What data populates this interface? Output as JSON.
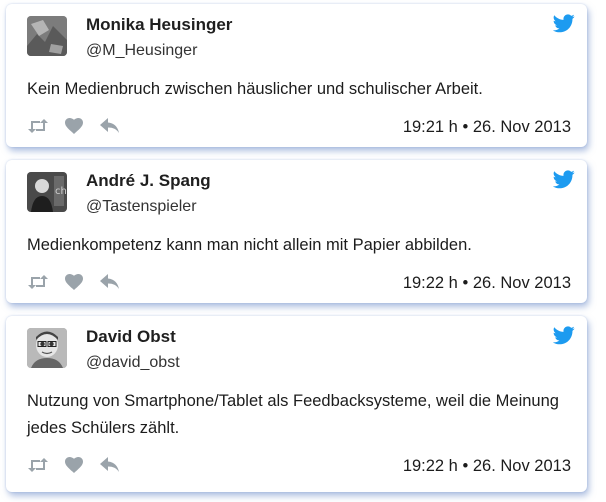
{
  "colors": {
    "twitter_blue": "#1d9bf0",
    "icon_gray": "#9aa3aa"
  },
  "tweets": [
    {
      "name": "Monika Heusinger",
      "handle": "@M_Heusinger",
      "text": "Kein Medienbruch zwischen häuslicher und schulischer Arbeit.",
      "time": "19:21 h",
      "separator": "•",
      "date": "26. Nov 2013"
    },
    {
      "name": "André J. Spang",
      "handle": "@Tastenspieler",
      "text": "Medienkompetenz kann man nicht allein mit Papier abbilden.",
      "time": "19:22 h",
      "separator": "•",
      "date": "26. Nov 2013"
    },
    {
      "name": "David Obst",
      "handle": "@david_obst",
      "text": "Nutzung von Smartphone/Tablet als Feedbacksysteme, weil die Meinung jedes Schülers zählt.",
      "time": "19:22 h",
      "separator": "•",
      "date": "26. Nov 2013"
    }
  ]
}
